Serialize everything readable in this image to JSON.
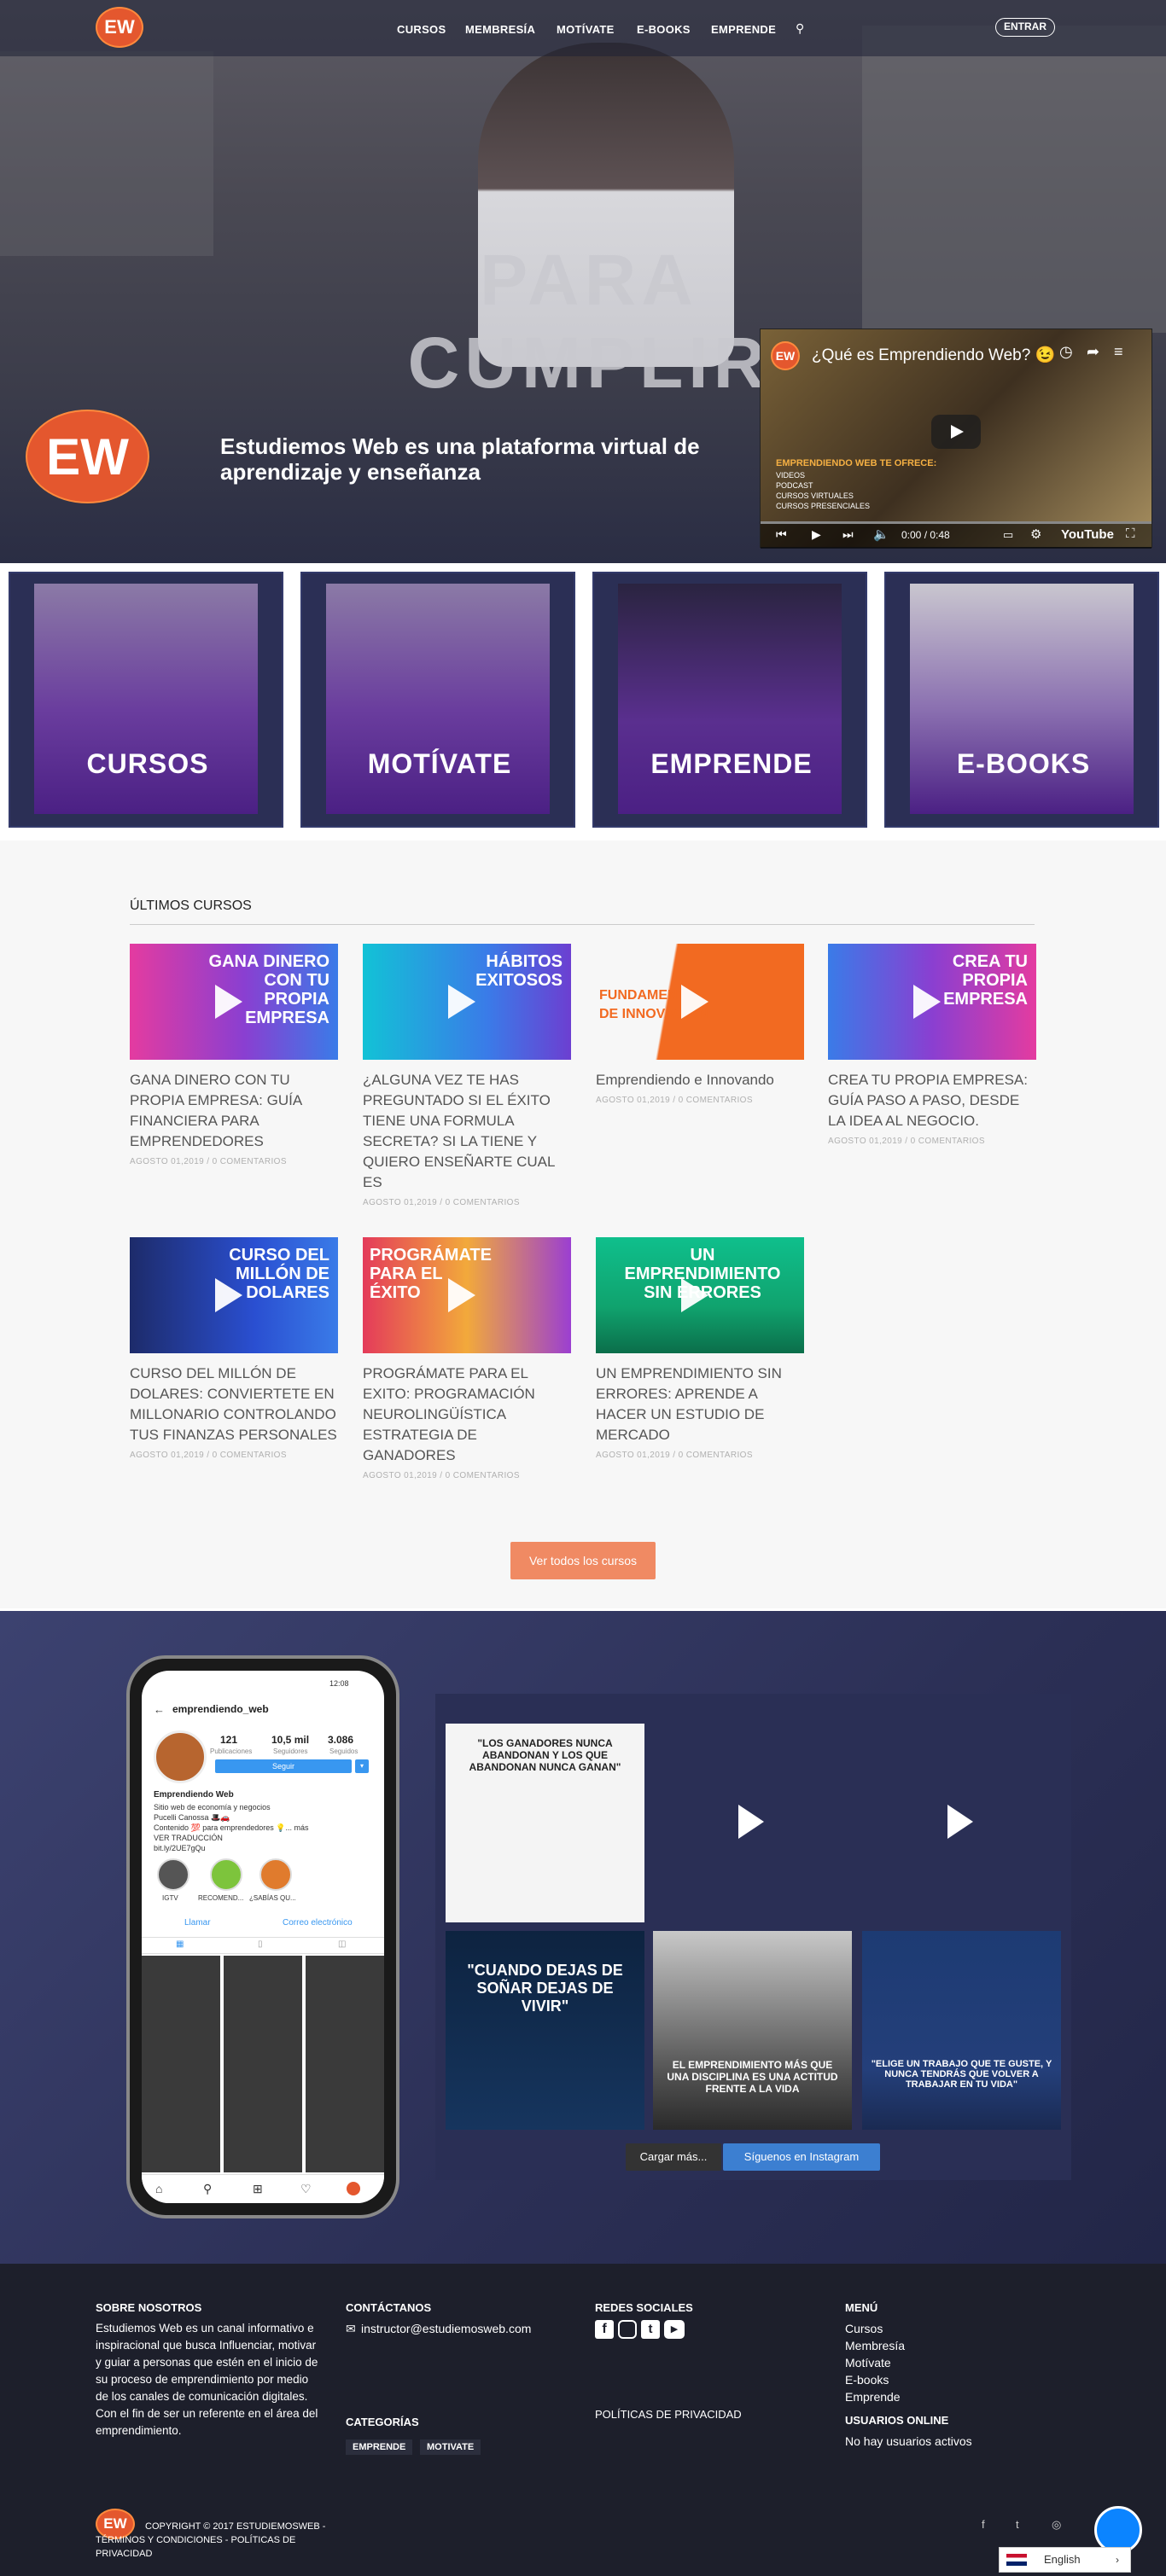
{
  "nav": {
    "links": [
      "CURSOS",
      "MEMBRESÍA",
      "MOTÍVATE",
      "E-BOOKS",
      "EMPRENDE"
    ],
    "login": "ENTRAR",
    "logo": "EW"
  },
  "hero": {
    "overlay_text": "PARA CUMPLIR",
    "tagline": "Estudiemos Web es una plataforma virtual de aprendizaje y enseñanza",
    "video": {
      "title": "¿Qué es Emprendiendo Web? 😉",
      "offer": "EMPRENDIENDO WEB TE OFRECE:",
      "items": "VIDEOS\nPODCAST\nCURSOS VIRTUALES\nCURSOS PRESENCIALES",
      "time": "0:00 / 0:48",
      "brand": "YouTube"
    }
  },
  "categories": [
    "CURSOS",
    "MOTÍVATE",
    "EMPRENDE",
    "E-BOOKS"
  ],
  "latest": {
    "heading": "ÚLTIMOS CURSOS",
    "button": "Ver todos los cursos",
    "courses": [
      {
        "title": "GANA DINERO CON TU PROPIA EMPRESA: GUÍA FINANCIERA PARA EMPRENDEDORES",
        "meta": "AGOSTO 01,2019 / 0 COMENTARIOS",
        "thumb": "GANA DINERO CON TU PROPIA EMPRESA"
      },
      {
        "title": "¿ALGUNA VEZ TE HAS PREGUNTADO SI EL ÉXITO TIENE UNA FORMULA SECRETA? SI LA TIENE Y QUIERO ENSEÑARTE CUAL ES",
        "meta": "AGOSTO 01,2019 / 0 COMENTARIOS",
        "thumb": "HÁBITOS EXITOSOS"
      },
      {
        "title": "Emprendiendo e Innovando",
        "meta": "AGOSTO 01,2019 / 0 COMENTARIOS",
        "thumb": "FUNDAMENTOS DE INNOVACIÓN"
      },
      {
        "title": "CREA TU PROPIA EMPRESA: GUÍA PASO A PASO, DESDE LA IDEA AL NEGOCIO.",
        "meta": "AGOSTO 01,2019 / 0 COMENTARIOS",
        "thumb": "CREA TU PROPIA EMPRESA"
      },
      {
        "title": "CURSO DEL MILLÓN DE DOLARES: CONVIERTETE EN MILLONARIO CONTROLANDO TUS FINANZAS PERSONALES",
        "meta": "AGOSTO 01,2019 / 0 COMENTARIOS",
        "thumb": "CURSO DEL MILLÓN DE DOLARES"
      },
      {
        "title": "PROGRÁMATE PARA EL EXITO: PROGRAMACIÓN NEUROLINGÜÍSTICA ESTRATEGIA DE GANADORES",
        "meta": "AGOSTO 01,2019 / 0 COMENTARIOS",
        "thumb": "PROGRÁMATE PARA EL ÉXITO"
      },
      {
        "title": "UN EMPRENDIMIENTO SIN ERRORES: APRENDE A HACER UN ESTUDIO DE MERCADO",
        "meta": "AGOSTO 01,2019 / 0 COMENTARIOS",
        "thumb": "UN EMPRENDIMIENTO SIN ERRORES"
      }
    ]
  },
  "instagram": {
    "handle": "emprendiendo_web",
    "posts": "121",
    "posts_label": "Publicaciones",
    "followers": "10,5 mil",
    "followers_label": "Seguidores",
    "following": "3.086",
    "following_label": "Seguidos",
    "follow_btn": "Seguir",
    "name": "Emprendiendo Web",
    "bio": "Sitio web de economía y negocios\nPucelli Canossa 🎩🚗\nContenido 💯 para emprendedores 💡... más\nVER TRADUCCIÓN\nbit.ly/2UE7gQu",
    "highlights": [
      "IGTV",
      "RECOMEND...",
      "¿SABÍAS QU..."
    ],
    "call": "Llamar",
    "email": "Correo electrónico",
    "time": "12:08",
    "quote1": "\"LOS GANADORES NUNCA ABANDONAN Y LOS QUE ABANDONAN NUNCA GANAN\"",
    "quote2": "\"CUANDO DEJAS DE SOÑAR DEJAS DE VIVIR\"",
    "quote3": "EL EMPRENDIMIENTO MÁS QUE UNA DISCIPLINA ES UNA ACTITUD FRENTE A LA VIDA",
    "quote4": "\"ELIGE UN TRABAJO QUE TE GUSTE, Y NUNCA TENDRÁS QUE VOLVER A TRABAJAR EN TU VIDA\"",
    "load_more": "Cargar más...",
    "follow_label": "Síguenos en Instagram"
  },
  "footer": {
    "about_h": "SOBRE NOSOTROS",
    "about": "Estudiemos Web es un canal informativo e inspiracional que busca  Influenciar, motivar y guiar a personas que estén en el inicio de su proceso de emprendimiento por medio de los canales de comunicación digitales. Con el fin de ser un referente en el área del emprendimiento.",
    "contact_h": "CONTÁCTANOS",
    "email": "instructor@estudiemosweb.com",
    "cat_h": "CATEGORÍAS",
    "cat_tags": [
      "EMPRENDE",
      "MOTIVATE"
    ],
    "social_h": "REDES SOCIALES",
    "privacy": "POLÍTICAS DE PRIVACIDAD",
    "menu_h": "MENÚ",
    "menu": [
      "Cursos",
      "Membresía",
      "Motívate",
      "E-books",
      "Emprende"
    ],
    "users_h": "USUARIOS ONLINE",
    "users": "No hay usuarios activos",
    "copyright": "COPYRIGHT © 2017 ESTUDIEMOSWEB - TÉRMINOS Y CONDICIONES - POLÍTICAS DE PRIVACIDAD",
    "lang": "English"
  }
}
